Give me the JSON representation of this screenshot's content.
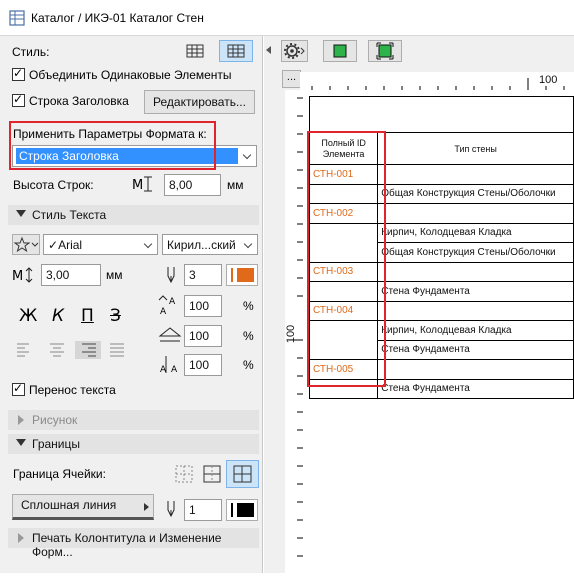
{
  "window": {
    "title": "Каталог / ИКЭ-01 Каталог Стен"
  },
  "left": {
    "style_label": "Стиль:",
    "merge_label": "Объединить Одинаковые Элементы",
    "header_row_label": "Строка Заголовка",
    "edit_button": "Редактировать...",
    "apply_format_label": "Применить Параметры Формата к:",
    "apply_format_value": "Строка Заголовка",
    "row_height_label": "Высота Строк:",
    "row_height_value": "8,00",
    "row_height_unit": "мм",
    "text_style_section": "Стиль Текста",
    "font_name": "Arial",
    "font_script": "Кирил...ский",
    "font_size_value": "3,00",
    "font_size_unit": "мм",
    "pen_value": "3",
    "pct1": "100",
    "pct2": "100",
    "pct3": "100",
    "pct_unit": "%",
    "bold_glyph": "Ж",
    "italic_glyph": "К",
    "underline_glyph": "П",
    "strike_glyph": "З",
    "wrap_label": "Перенос текста",
    "picture_section": "Рисунок",
    "borders_section": "Границы",
    "cell_border_label": "Граница Ячейки:",
    "line_type": "Сплошная линия",
    "border_pen_value": "1",
    "footer_section": "Печать Колонтитула и Изменение Форм...",
    "accent_color": "#e06a1a",
    "select_color": "#3390ff"
  },
  "right": {
    "ruler_dots": "...",
    "ruler_100": "100",
    "ruler_v_100": "100",
    "col1_header": "Полный ID Элемента",
    "col2_header": "Тип стены",
    "rows": [
      {
        "id": "СТН-001",
        "type": ""
      },
      {
        "id": "",
        "type": "Общая Конструкция Стены/Оболочки"
      },
      {
        "id": "СТН-002",
        "type": ""
      },
      {
        "id": "",
        "type": "Кирпич, Колодцевая Кладка"
      },
      {
        "id": "",
        "type": "Общая Конструкция Стены/Оболочки"
      },
      {
        "id": "СТН-003",
        "type": ""
      },
      {
        "id": "",
        "type": "Стена Фундамента"
      },
      {
        "id": "СТН-004",
        "type": ""
      },
      {
        "id": "",
        "type": "Кирпич, Колодцевая Кладка"
      },
      {
        "id": "",
        "type": "Стена Фундамента"
      },
      {
        "id": "СТН-005",
        "type": ""
      },
      {
        "id": "",
        "type": "Стена Фундамента"
      }
    ]
  }
}
